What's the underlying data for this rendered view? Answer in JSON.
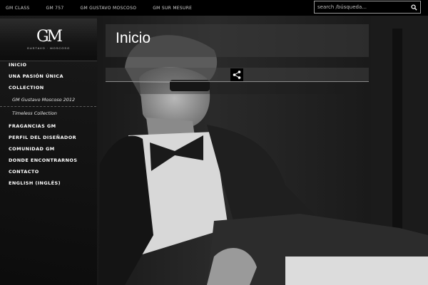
{
  "top_nav": {
    "items": [
      {
        "label": "GM CLASS"
      },
      {
        "label": "GM 757"
      },
      {
        "label": "GM GUSTAVO MOSCOSO"
      },
      {
        "label": "GM SUR MESURE"
      }
    ]
  },
  "search": {
    "placeholder": "search /búsqueda...",
    "icon": "search-icon"
  },
  "logo": {
    "mark": "GM",
    "subtitle": "GUSTAVO · MOSCOSO"
  },
  "sidebar": {
    "items": [
      {
        "label": "INICIO"
      },
      {
        "label": "UNA PASIÓN ÚNICA"
      },
      {
        "label": "COLLECTION"
      },
      {
        "label": "GM Gustavo Moscoso 2012"
      },
      {
        "label": "Timeless Collection"
      },
      {
        "label": "FRAGANCIAS GM"
      },
      {
        "label": "PERFIL DEL DISEÑADOR"
      },
      {
        "label": "COMUNIDAD GM"
      },
      {
        "label": "DONDE ENCONTRARNOS"
      },
      {
        "label": "CONTACTO"
      },
      {
        "label": "ENGLISH (INGLÉS)"
      }
    ]
  },
  "page": {
    "title": "Inicio",
    "share_icon": "share-icon"
  }
}
